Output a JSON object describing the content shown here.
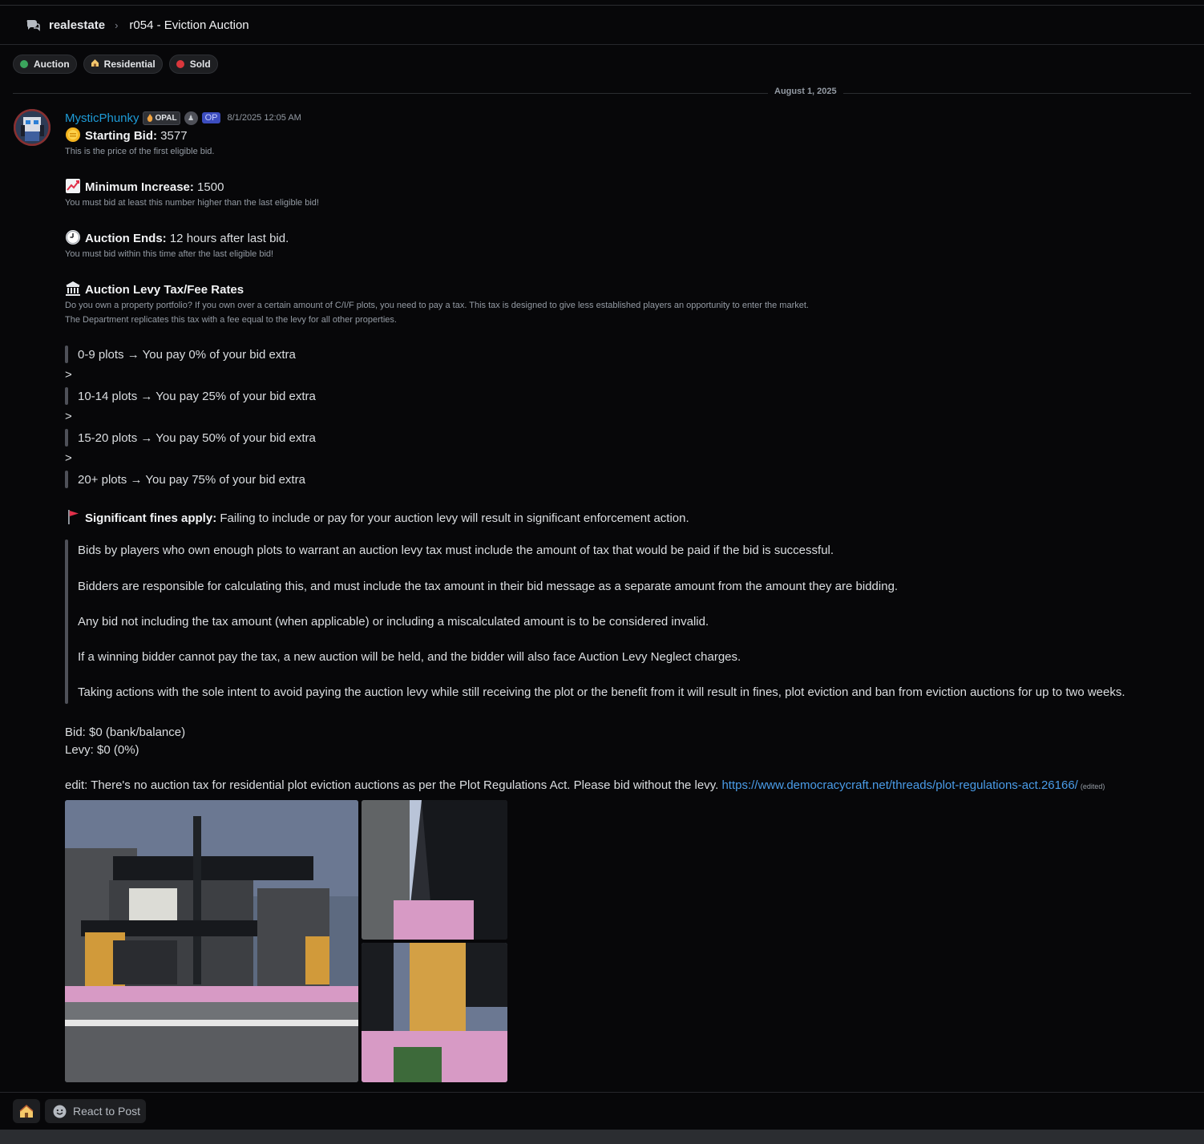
{
  "breadcrumb": {
    "forum": "realestate",
    "separator": "›",
    "post_title": "r054 - Eviction Auction"
  },
  "tags": [
    {
      "label": "Auction",
      "icon": "green-dot",
      "color": "#3ba55d"
    },
    {
      "label": "Residential",
      "icon": "house-icon"
    },
    {
      "label": "Sold",
      "icon": "red-dot",
      "color": "#da373c"
    }
  ],
  "date_divider": "August 1, 2025",
  "message": {
    "author": "MysticPhunky",
    "badge_opal": "OPAL",
    "badge_op": "OP",
    "timestamp": "8/1/2025 12:05 AM",
    "starting_bid": {
      "label": "Starting Bid:",
      "value": " 3577",
      "note": "This is the price of the first eligible bid."
    },
    "min_increase": {
      "label": "Minimum Increase:",
      "value": " 1500",
      "note": "You must bid at least this number higher than the last eligible bid!"
    },
    "auction_ends": {
      "label": "Auction Ends:",
      "value": " 12 hours after last bid.",
      "note": "You must bid within this time after the last eligible bid!"
    },
    "levy": {
      "label": "Auction Levy Tax/Fee Rates",
      "note1": "Do you own a property portfolio? If you own over a certain amount of C/I/F plots, you need to pay a tax. This tax is designed to give less established players an opportunity to enter the market.",
      "note2": "The Department replicates this tax with a fee equal to the levy for all other properties.",
      "rates": [
        "0-9 plots → You pay 0% of your bid extra",
        "10-14 plots → You pay 25% of your bid extra",
        "15-20 plots → You pay 50% of your bid extra",
        "20+ plots → You pay 75% of your bid extra"
      ],
      "separator": ">"
    },
    "fines": {
      "label": "Significant fines apply:",
      "text": " Failing to include or pay for your auction levy will result in significant enforcement action."
    },
    "rules": [
      "Bids by players who own enough plots to warrant an auction levy tax must include the amount of tax that would be paid if the bid is successful.",
      "Bidders are responsible for calculating this, and must include the tax amount in their bid message as a separate amount from the amount they are bidding.",
      "Any bid not including the tax amount (when applicable) or including a miscalculated amount is to be considered invalid.",
      "If a winning bidder cannot pay the tax, a new auction will be held, and the bidder will also face Auction Levy Neglect charges.",
      "Taking actions with the sole intent to avoid paying the auction levy while still receiving the plot or the benefit from it will result in fines, plot eviction and ban from eviction auctions for up to two weeks."
    ],
    "bid_line": "Bid: $0 (bank/balance)",
    "levy_line": "Levy: $0 (0%)",
    "edit_text": "edit: There's no auction tax for residential plot eviction auctions as per the Plot Regulations Act. Please bid without the levy. ",
    "edit_link": "https://www.democracycraft.net/threads/plot-regulations-act.26166/",
    "edited_label": "(edited)"
  },
  "reactions": {
    "home_emoji": "house-emoji",
    "react_label": "React to Post"
  },
  "colors": {
    "background": "#070709",
    "author": "#1e9bd7",
    "link": "#4a9ce8",
    "muted": "#949ba4"
  }
}
